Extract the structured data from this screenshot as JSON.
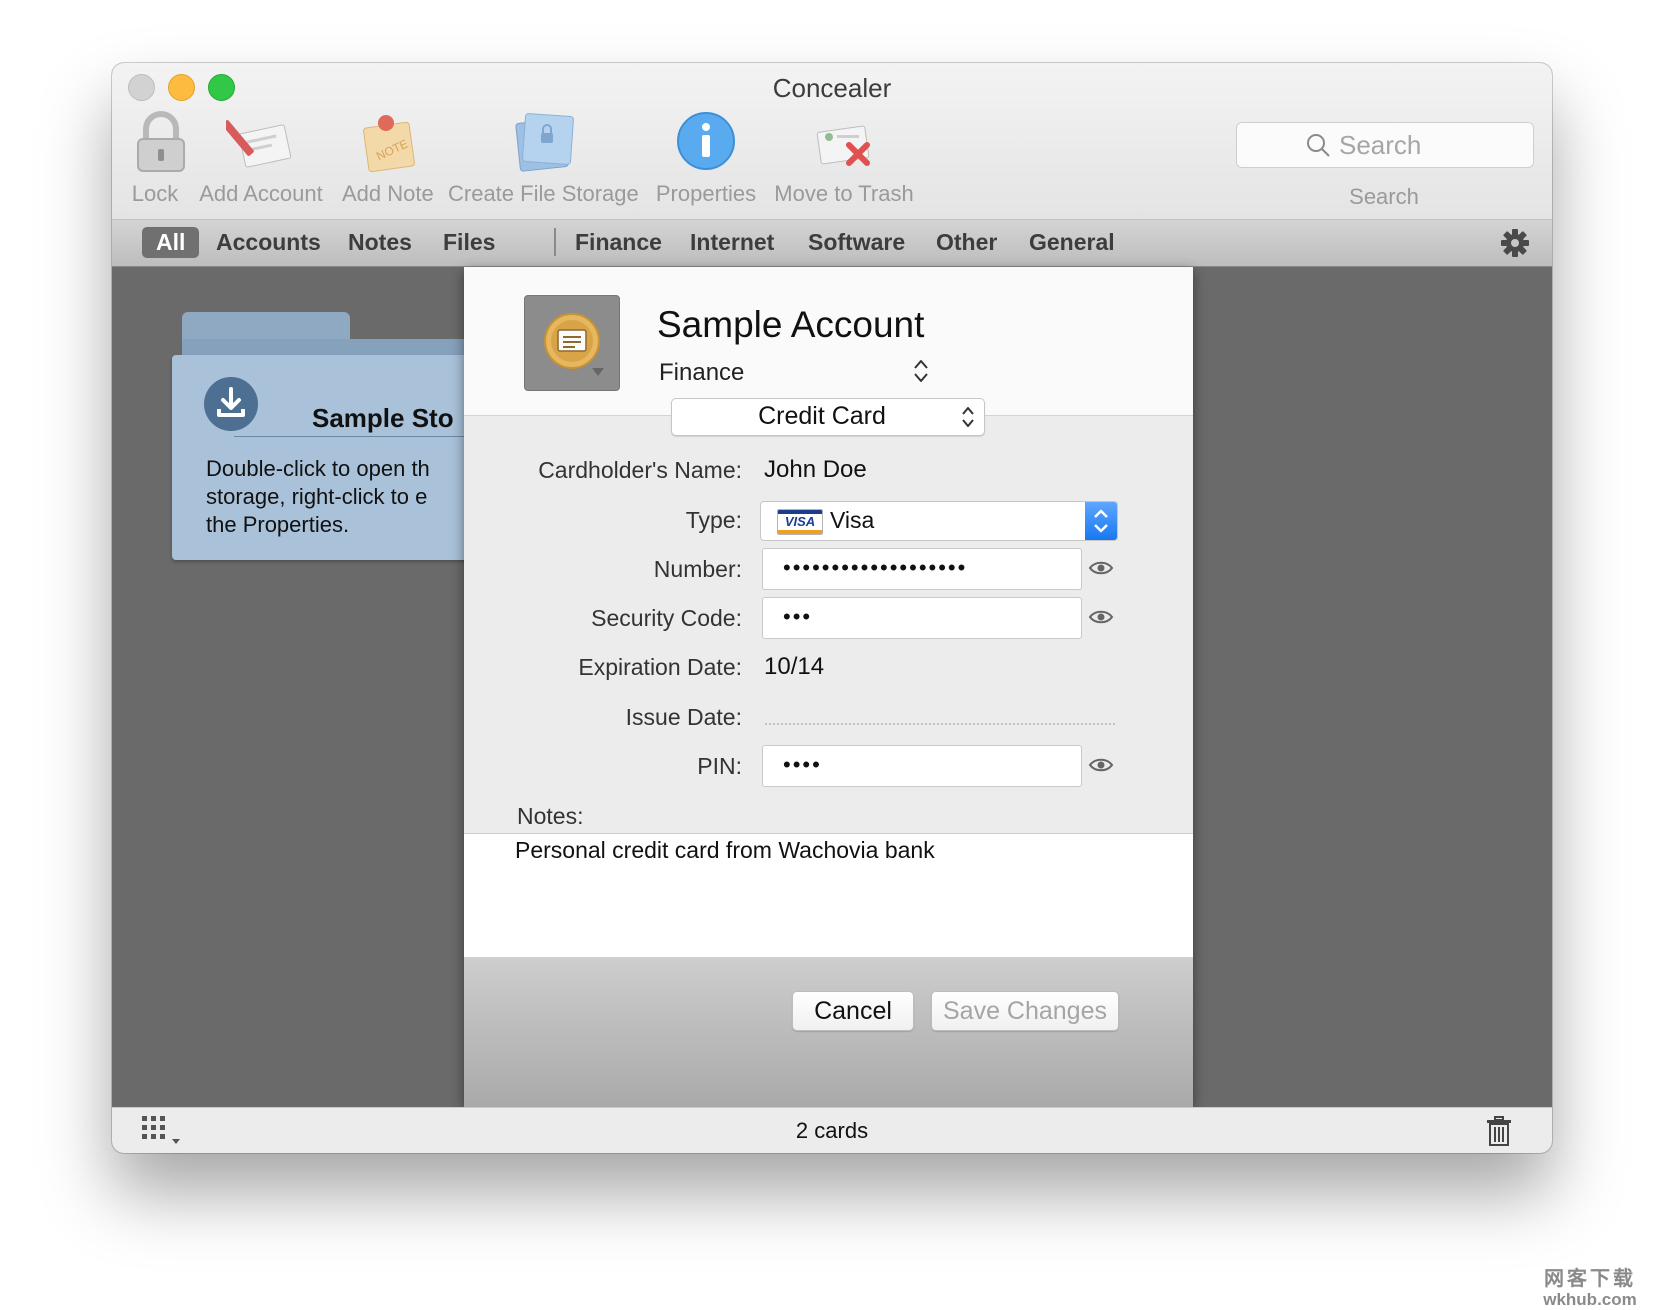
{
  "window": {
    "title": "Concealer"
  },
  "toolbar": {
    "lock_label": "Lock",
    "add_account_label": "Add Account",
    "add_note_label": "Add Note",
    "create_file_storage_label": "Create File Storage",
    "properties_label": "Properties",
    "move_to_trash_label": "Move to Trash",
    "search_placeholder": "Search",
    "search_caption": "Search"
  },
  "tabs": {
    "all": "All",
    "accounts": "Accounts",
    "notes": "Notes",
    "files": "Files",
    "finance": "Finance",
    "internet": "Internet",
    "software": "Software",
    "other": "Other",
    "general": "General",
    "active": "All"
  },
  "storage_card": {
    "name": "Sample Sto",
    "desc_line1": "Double-click to open th",
    "desc_line2": "storage, right-click to e",
    "desc_line3": "the Properties."
  },
  "editor": {
    "account_name": "Sample Account",
    "category": "Finance",
    "card_type": "Credit Card",
    "fields": {
      "cardholder_label": "Cardholder's Name:",
      "cardholder_value": "John Doe",
      "type_label": "Type:",
      "type_value": "Visa",
      "type_logo": "VISA",
      "number_label": "Number:",
      "number_value": "•••••••••••••••••••",
      "security_label": "Security Code:",
      "security_value": "•••",
      "expiration_label": "Expiration Date:",
      "expiration_value": "10/14",
      "issue_label": "Issue Date:",
      "pin_label": "PIN:",
      "pin_value": "••••"
    },
    "notes_label": "Notes:",
    "notes_value": "Personal credit card from Wachovia bank",
    "cancel_label": "Cancel",
    "save_label": "Save Changes"
  },
  "statusbar": {
    "count_text": "2 cards"
  },
  "watermark": {
    "line1": "网客下载",
    "line2": "wkhub.com"
  },
  "colors": {
    "accent_blue": "#1778f2",
    "folder_blue": "#a9c2d9",
    "traffic_close": "#d2d2d2",
    "traffic_min": "#fdbc40",
    "traffic_max": "#33c748"
  }
}
